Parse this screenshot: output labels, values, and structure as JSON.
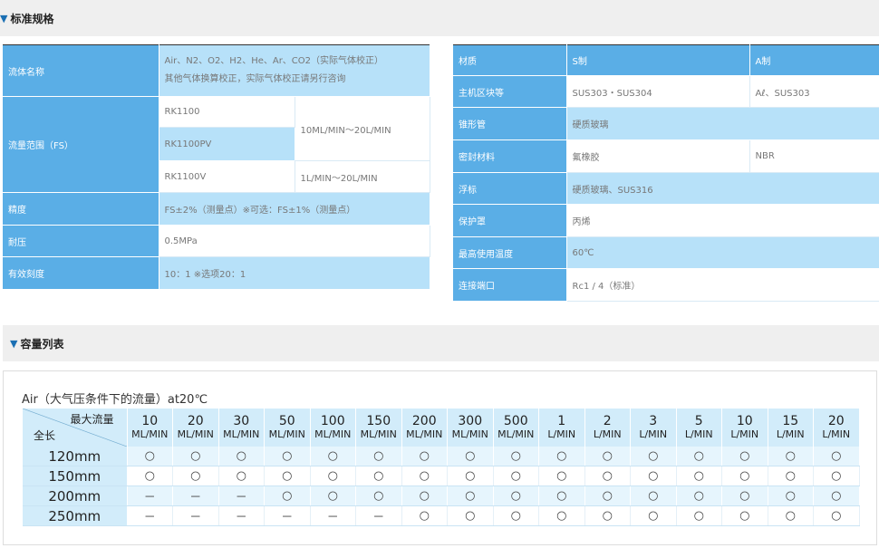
{
  "section1": {
    "title": "标准规格"
  },
  "section2": {
    "title": "容量列表"
  },
  "left_spec": {
    "gas_label": "流体名称",
    "gas_line1": "Air、N2、O2、H2、He、Ar、CO2（实际气体校正）",
    "gas_line2": "其他气体换算校正，实际气体校正请另行咨询",
    "range_label": "流量范围（FS）",
    "model1": "RK1100",
    "model2": "RK1100PV",
    "model3": "RK1100V",
    "range_a": "10ML/MIN〜20L/MIN",
    "range_b": "1L/MIN〜20L/MIN",
    "accuracy_label": "精度",
    "accuracy_value": "FS±2%（测量点）※可选：FS±1%（测量点）",
    "pressure_label": "耐压",
    "pressure_value": "0.5MPa",
    "scale_label": "有效刻度",
    "scale_value": "10：1 ※选项20：1"
  },
  "right_spec": {
    "col_material": "材质",
    "col_s": "S制",
    "col_a": "A制",
    "block_label": "主机区块等",
    "block_s": "SUS303・SUS304",
    "block_a": "Aℓ、SUS303",
    "tube_label": "锥形管",
    "tube_value": "硬质玻璃",
    "seal_label": "密封材料",
    "seal_s": "氟橡胶",
    "seal_a": "NBR",
    "float_label": "浮标",
    "float_value": "硬质玻璃、SUS316",
    "cover_label": "保护罩",
    "cover_value": "丙烯",
    "temp_label": "最高使用温度",
    "temp_value": "60℃",
    "port_label": "连接端口",
    "port_value": "Rc1 / 4（标准）"
  },
  "capacity": {
    "caption": "Air（大气压条件下的流量）at20℃",
    "corner_top": "最大流量",
    "corner_bottom": "全长",
    "columns": [
      {
        "num": "10",
        "unit": "ML/MIN"
      },
      {
        "num": "20",
        "unit": "ML/MIN"
      },
      {
        "num": "30",
        "unit": "ML/MIN"
      },
      {
        "num": "50",
        "unit": "ML/MIN"
      },
      {
        "num": "100",
        "unit": "ML/MIN"
      },
      {
        "num": "150",
        "unit": "ML/MIN"
      },
      {
        "num": "200",
        "unit": "ML/MIN"
      },
      {
        "num": "300",
        "unit": "ML/MIN"
      },
      {
        "num": "500",
        "unit": "ML/MIN"
      },
      {
        "num": "1",
        "unit": "L/MIN"
      },
      {
        "num": "2",
        "unit": "L/MIN"
      },
      {
        "num": "3",
        "unit": "L/MIN"
      },
      {
        "num": "5",
        "unit": "L/MIN"
      },
      {
        "num": "10",
        "unit": "L/MIN"
      },
      {
        "num": "15",
        "unit": "L/MIN"
      },
      {
        "num": "20",
        "unit": "L/MIN"
      }
    ],
    "rows": [
      {
        "length": "120mm",
        "cells": [
          "○",
          "○",
          "○",
          "○",
          "○",
          "○",
          "○",
          "○",
          "○",
          "○",
          "○",
          "○",
          "○",
          "○",
          "○",
          "○"
        ]
      },
      {
        "length": "150mm",
        "cells": [
          "○",
          "○",
          "○",
          "○",
          "○",
          "○",
          "○",
          "○",
          "○",
          "○",
          "○",
          "○",
          "○",
          "○",
          "○",
          "○"
        ]
      },
      {
        "length": "200mm",
        "cells": [
          "－",
          "－",
          "－",
          "○",
          "○",
          "○",
          "○",
          "○",
          "○",
          "○",
          "○",
          "○",
          "○",
          "○",
          "○",
          "○"
        ]
      },
      {
        "length": "250mm",
        "cells": [
          "－",
          "－",
          "－",
          "－",
          "－",
          "－",
          "○",
          "○",
          "○",
          "○",
          "○",
          "○",
          "○",
          "○",
          "○",
          "○"
        ]
      }
    ]
  }
}
